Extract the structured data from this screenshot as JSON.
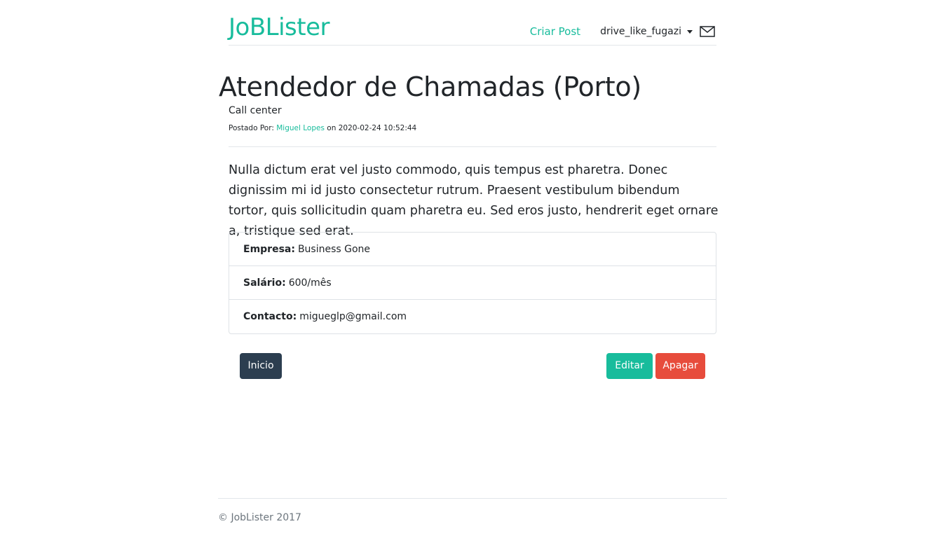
{
  "navbar": {
    "brand": "JoBLister",
    "create_post_label": "Criar Post",
    "username": "drive_like_fugazi",
    "mail_icon": "envelope-icon"
  },
  "job": {
    "title": "Atendedor de Chamadas (Porto)",
    "category": "Call center",
    "posted_by_label": "Postado Por:",
    "author": "Miguel Lopes",
    "on_label": "on",
    "date": "2020-02-24 10:52:44",
    "description": "Nulla dictum erat vel justo commodo, quis tempus est pharetra. Donec dignissim mi id justo consectetur rutrum. Praesent vestibulum bibendum tortor, quis sollicitudin quam pharetra eu. Sed eros justo, hendrerit eget ornare a, tristique sed erat.",
    "details": [
      {
        "label": "Empresa:",
        "value": "Business Gone"
      },
      {
        "label": "Salário:",
        "value": "600/mês"
      },
      {
        "label": "Contacto:",
        "value": "migueglp@gmail.com"
      }
    ]
  },
  "actions": {
    "home_label": "Inicio",
    "edit_label": "Editar",
    "delete_label": "Apagar"
  },
  "footer": {
    "text": "© JobLister 2017"
  },
  "colors": {
    "accent": "#18bc9c",
    "primary": "#2c3e50",
    "danger": "#e74c3c"
  }
}
